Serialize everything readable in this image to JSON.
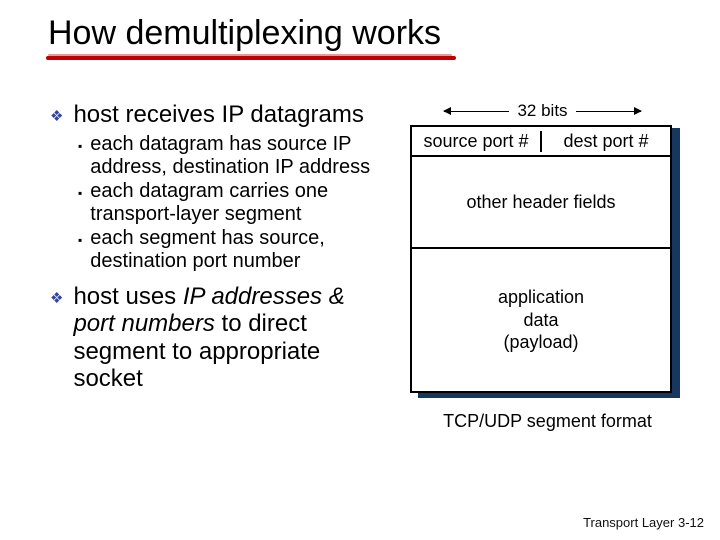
{
  "title": "How demultiplexing works",
  "left": {
    "b1": "host receives IP datagrams",
    "b1_subs": {
      "s1": "each datagram has source IP address, destination IP address",
      "s2": "each datagram carries one transport-layer segment",
      "s3": "each segment has source, destination port number"
    },
    "b2_pre": "host uses ",
    "b2_it": "IP addresses & port numbers",
    "b2_post": " to direct segment to appropriate socket"
  },
  "diagram": {
    "bits": "32 bits",
    "src": "source port #",
    "dst": "dest port #",
    "other": "other header fields",
    "payload_l1": "application",
    "payload_l2": "data",
    "payload_l3": "(payload)",
    "caption": "TCP/UDP segment format"
  },
  "footer": {
    "label": "Transport Layer",
    "page": "3-12"
  }
}
